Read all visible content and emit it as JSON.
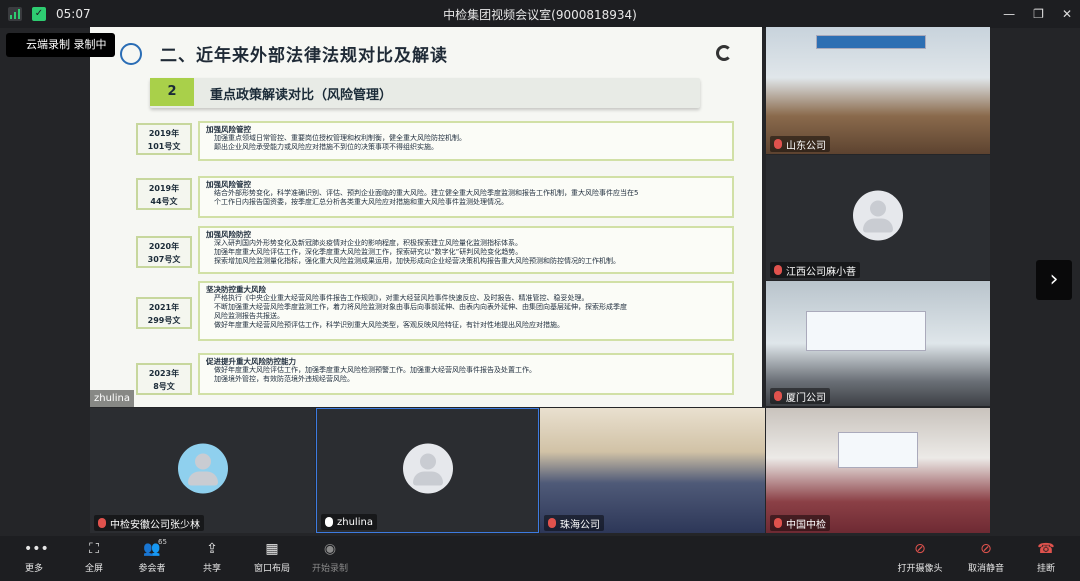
{
  "window": {
    "title": "中检集团视频会议室(9000818934)",
    "time": "05:07"
  },
  "recording": {
    "label": "云端录制 录制中"
  },
  "slide": {
    "title": "二、近年来外部法律法规对比及解读",
    "section_num": "2",
    "section_title": "重点政策解读对比（风险管理）",
    "rows": [
      {
        "year": "2019年",
        "doc": "101号文",
        "heading": "加强风险管控",
        "lines": [
          "加强重点领域日常管控、重要岗位授权管理和权利制衡，健全重大风险防控机制。",
          "颠出企业风险承受能力或风险应对措施不到位的决策事项不得组织实施。"
        ]
      },
      {
        "year": "2019年",
        "doc": "44号文",
        "heading": "加强风险管控",
        "lines": [
          "结合外部形势变化，科学准确识别、评估、预判企业面临的重大风险。建立健全重大风险季度监测和报告工作机制，重大风险事件应当在5",
          "个工作日内报告国资委，按季度汇总分析各类重大风险应对措施和重大风险事件监测处理情况。"
        ]
      },
      {
        "year": "2020年",
        "doc": "307号文",
        "heading": "加强风险防控",
        "lines": [
          "深入研判国内外形势变化及新冠肺炎疫情对企业的影响程度，积极探索建立风险量化监测指标体系。",
          "加强年度重大风险评估工作，深化季度重大风险监测工作，探索研究以“数字化”研判风险变化趋势。",
          "探索增加风险监测量化指标，强化重大风险监测成果运用，加快形成向企业经营决策机构报告重大风险预测和防控情况的工作机制。"
        ]
      },
      {
        "year": "2021年",
        "doc": "299号文",
        "heading": "坚决防控重大风险",
        "lines": [
          "严格执行《中央企业重大经营风险事件报告工作规则》，对重大经营风险事件快速反应、及时报告、精准管控、稳妥处理。",
          "不断加强重大经营风险季度监测工作，着力将风险监测对象由事后向事前延伸、由表内向表外延伸、由集团向基层延伸，探索形成季度",
          "风险监测报告共报送。",
          "做好年度重大经营风险预评估工作，科学识别重大风险类型，客观反映风险特征，有针对性地提出风险应对措施。"
        ]
      },
      {
        "year": "2023年",
        "doc": "8号文",
        "heading": "促进提升重大风险防控能力",
        "lines": [
          "做好年度重大风险评估工作，加强季度重大风险检测预警工作。加强重大经营风险事件报告及处置工作。",
          "加强境外管控，有效防范境外违规经营风险。"
        ]
      }
    ],
    "presenter": "zhulina"
  },
  "participants": [
    {
      "name": "山东公司",
      "muted": true
    },
    {
      "name": "江西公司麻小菩",
      "muted": true
    },
    {
      "name": "厦门公司",
      "muted": true
    },
    {
      "name": "中检安徽公司张少林",
      "muted": true
    },
    {
      "name": "zhulina",
      "muted": false
    },
    {
      "name": "珠海公司",
      "muted": true
    },
    {
      "name": "中国中检",
      "muted": true
    }
  ],
  "toolbar": {
    "more": "更多",
    "fullscreen": "全屏",
    "participants": "参会者",
    "participants_count": "65",
    "share": "共享",
    "layout": "窗口布局",
    "record": "开始录制",
    "camera": "打开摄像头",
    "mute": "取消静音",
    "hangup": "挂断"
  }
}
